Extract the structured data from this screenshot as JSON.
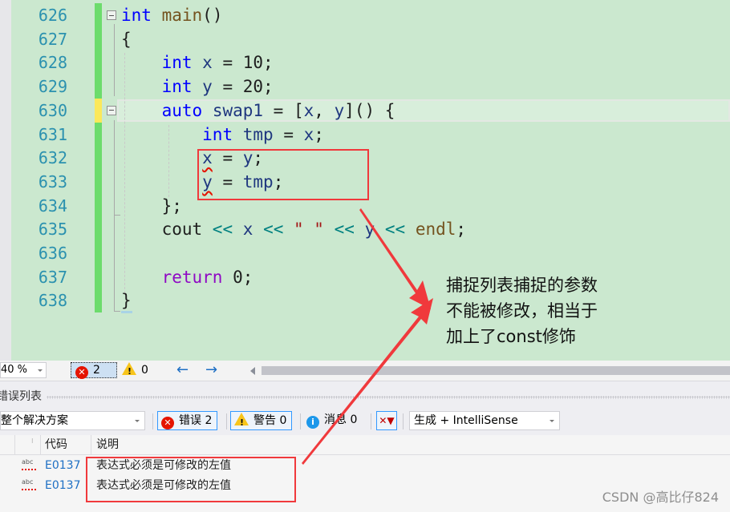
{
  "editor": {
    "lines": [
      {
        "num": "626",
        "tokens": [
          {
            "t": "int",
            "c": "kw"
          },
          {
            "t": " "
          },
          {
            "t": "main",
            "c": "fn"
          },
          {
            "t": "()"
          }
        ]
      },
      {
        "num": "627",
        "tokens": [
          {
            "t": "{"
          }
        ]
      },
      {
        "num": "628",
        "tokens": [
          {
            "t": "    "
          },
          {
            "t": "int",
            "c": "kw"
          },
          {
            "t": " "
          },
          {
            "t": "x",
            "c": "var"
          },
          {
            "t": " = 10;"
          }
        ]
      },
      {
        "num": "629",
        "tokens": [
          {
            "t": "    "
          },
          {
            "t": "int",
            "c": "kw"
          },
          {
            "t": " "
          },
          {
            "t": "y",
            "c": "var"
          },
          {
            "t": " = 20;"
          }
        ]
      },
      {
        "num": "630",
        "tokens": [
          {
            "t": "    "
          },
          {
            "t": "auto",
            "c": "kw"
          },
          {
            "t": " "
          },
          {
            "t": "swap1",
            "c": "var"
          },
          {
            "t": " = ["
          },
          {
            "t": "x",
            "c": "var"
          },
          {
            "t": ", "
          },
          {
            "t": "y",
            "c": "var"
          },
          {
            "t": "]() {"
          }
        ]
      },
      {
        "num": "631",
        "tokens": [
          {
            "t": "        "
          },
          {
            "t": "int",
            "c": "kw"
          },
          {
            "t": " "
          },
          {
            "t": "tmp",
            "c": "var"
          },
          {
            "t": " = "
          },
          {
            "t": "x",
            "c": "var"
          },
          {
            "t": ";"
          }
        ]
      },
      {
        "num": "632",
        "tokens": [
          {
            "t": "        "
          },
          {
            "t": "x",
            "c": "var squig"
          },
          {
            "t": " = "
          },
          {
            "t": "y",
            "c": "var"
          },
          {
            "t": ";"
          }
        ]
      },
      {
        "num": "633",
        "tokens": [
          {
            "t": "        "
          },
          {
            "t": "y",
            "c": "var squig"
          },
          {
            "t": " = "
          },
          {
            "t": "tmp",
            "c": "var"
          },
          {
            "t": ";"
          }
        ]
      },
      {
        "num": "634",
        "tokens": [
          {
            "t": "    };"
          }
        ]
      },
      {
        "num": "635",
        "tokens": [
          {
            "t": "    cout "
          },
          {
            "t": "<<",
            "c": "op"
          },
          {
            "t": " "
          },
          {
            "t": "x",
            "c": "var"
          },
          {
            "t": " "
          },
          {
            "t": "<<",
            "c": "op"
          },
          {
            "t": " "
          },
          {
            "t": "\" \"",
            "c": "str"
          },
          {
            "t": " "
          },
          {
            "t": "<<",
            "c": "op"
          },
          {
            "t": " "
          },
          {
            "t": "y",
            "c": "var"
          },
          {
            "t": " "
          },
          {
            "t": "<<",
            "c": "op"
          },
          {
            "t": " "
          },
          {
            "t": "endl",
            "c": "fn"
          },
          {
            "t": ";"
          }
        ]
      },
      {
        "num": "636",
        "tokens": []
      },
      {
        "num": "637",
        "tokens": [
          {
            "t": "    "
          },
          {
            "t": "return",
            "c": "ctl"
          },
          {
            "t": " 0;"
          }
        ]
      },
      {
        "num": "638",
        "tokens": [
          {
            "t": "}"
          }
        ]
      }
    ],
    "modified_line": "630"
  },
  "annotation": {
    "lines": [
      "捕捉列表捕捉的参数",
      "不能被修改，相当于",
      "加上了const修饰"
    ],
    "color": "#f0393c"
  },
  "statusbar": {
    "zoom": "40 %",
    "error_count": "2",
    "warning_count": "0",
    "back_icon": "arrow-left-icon",
    "forward_icon": "arrow-right-icon"
  },
  "error_list": {
    "title": "错误列表",
    "scope": "整个解决方案",
    "errors_label": "错误 2",
    "warnings_label": "警告 0",
    "messages_label": "消息 0",
    "build_filter": "生成 + IntelliSense",
    "columns": {
      "code": "代码",
      "description": "说明"
    },
    "rows": [
      {
        "icon": "abc-squiggle-icon",
        "code": "E0137",
        "description": "表达式必须是可修改的左值"
      },
      {
        "icon": "abc-squiggle-icon",
        "code": "E0137",
        "description": "表达式必须是可修改的左值"
      }
    ]
  },
  "watermark": "CSDN @高比仔824",
  "colors": {
    "editor_bg": "#cbe8cf",
    "gutter_saved": "#6cdc6c",
    "gutter_modified": "#fbe85a",
    "highlight_red": "#f0393c",
    "accent_blue": "#3399ff"
  }
}
